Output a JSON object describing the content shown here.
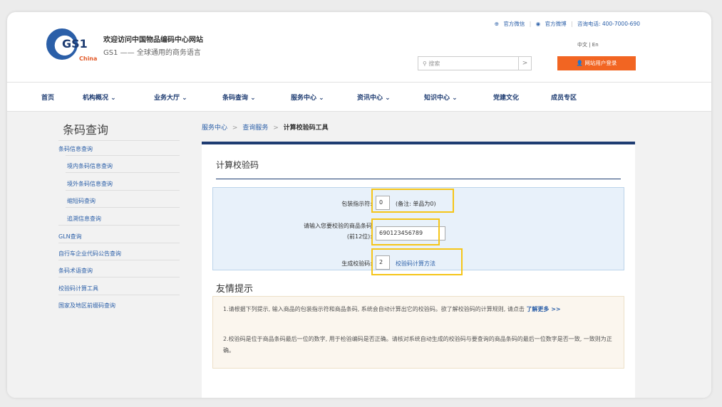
{
  "header": {
    "logo_text": "GS1",
    "logo_sub": "China",
    "welcome": "欢迎访问中国物品编码中心网站",
    "slogan": "GS1 —— 全球通用的商务语言",
    "links": {
      "wechat": "官方微信",
      "weibo": "官方微博",
      "hotline": "咨询电话: 400-7000-690"
    },
    "lang": "中文 | En",
    "search_placeholder": "搜索",
    "search_btn": ">",
    "login": "网站用户登录"
  },
  "nav": {
    "items": [
      {
        "label": "首页"
      },
      {
        "label": "机构概况 ⌄"
      },
      {
        "label": "业务大厅 ⌄"
      },
      {
        "label": "条码查询 ⌄"
      },
      {
        "label": "服务中心 ⌄"
      },
      {
        "label": "资讯中心 ⌄"
      },
      {
        "label": "知识中心 ⌄"
      },
      {
        "label": "党建文化"
      },
      {
        "label": "成员专区"
      }
    ]
  },
  "sidebar": {
    "title": "条码查询",
    "items": [
      {
        "label": "条码信息查询"
      },
      {
        "label": "境内条码信息查询"
      },
      {
        "label": "境外条码信息查询"
      },
      {
        "label": "缩短码查询"
      },
      {
        "label": "追溯信息查询"
      },
      {
        "label": "GLN查询"
      },
      {
        "label": "自行车企业代码公告查询"
      },
      {
        "label": "条码术语查询"
      },
      {
        "label": "校验码计算工具"
      },
      {
        "label": "国家及地区前缀码查询"
      }
    ]
  },
  "breadcrumb": {
    "level1": "服务中心",
    "sep": ">",
    "level2": "查询服务",
    "current": "计算校验码工具"
  },
  "panel": {
    "title": "计算校验码",
    "fields": {
      "indicator_label": "包装指示符:",
      "indicator_value": "0",
      "indicator_note": "(备注: 单品为0)",
      "code_label_1": "请输入您要校验的商品条码",
      "code_label_2": "(前12位):",
      "code_value": "690123456789",
      "check_label": "生成校验码:",
      "check_value": "2",
      "method_link": "校验码计算方法"
    },
    "tips_title": "友情提示",
    "tips": {
      "tip1": "1.请根据下列提示, 输入商品的包装指示符和商品条码, 系统会自动计算出它的校验码。欲了解校验码的计算规则, 请点击",
      "tip1_more": "了解更多 >>",
      "tip2": "2.校验码是位于商品条码最后一位的数字, 用于检验编码是否正确。请核对系统自动生成的校验码与要查询的商品条码的最后一位数字是否一致, 一致则为正确。"
    }
  },
  "colors": {
    "brand_blue": "#1e3c72",
    "link_blue": "#2b5fa8",
    "login_orange": "#f26522",
    "highlight_yellow": "#f5c518"
  }
}
